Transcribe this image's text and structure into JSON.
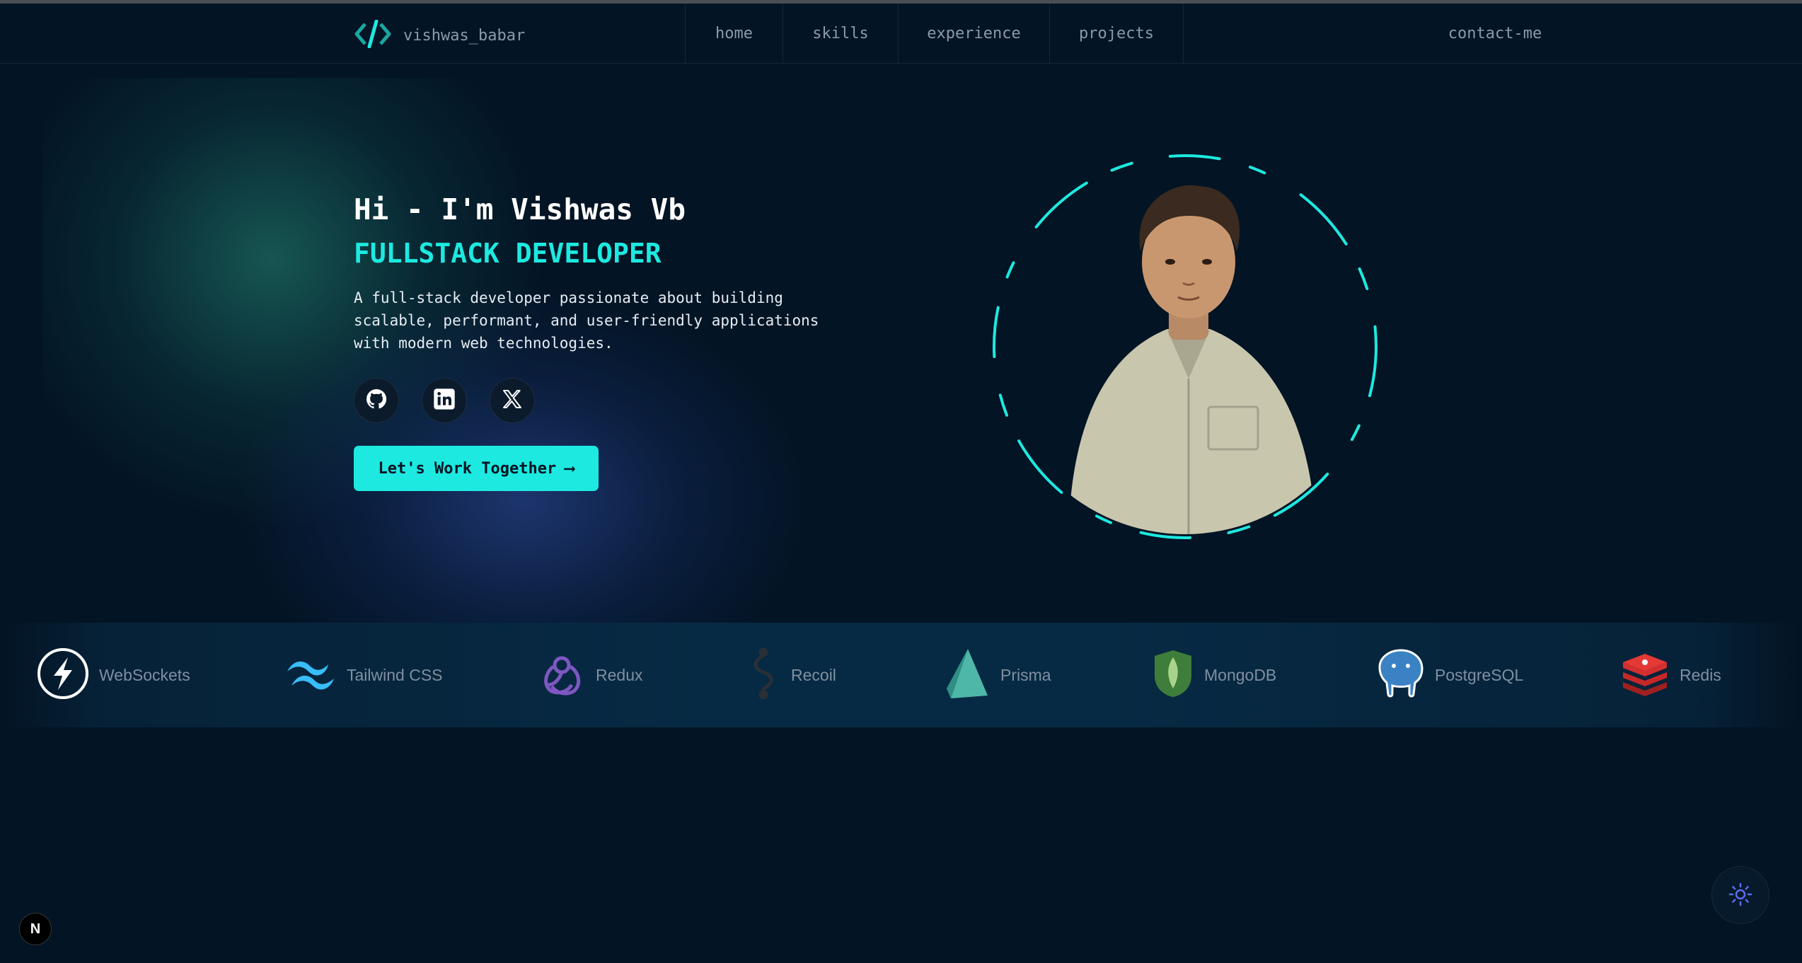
{
  "nav": {
    "brand_label": "vishwas_babar",
    "items": [
      {
        "label": "home"
      },
      {
        "label": "skills"
      },
      {
        "label": "experience"
      },
      {
        "label": "projects"
      },
      {
        "label": "contact-me"
      }
    ]
  },
  "hero": {
    "title": "Hi - I'm Vishwas Vb",
    "role": "FULLSTACK DEVELOPER",
    "description": "A full-stack developer passionate about building scalable, performant, and user-friendly applications with modern web technologies.",
    "socials": [
      {
        "icon": "github-icon"
      },
      {
        "icon": "linkedin-icon"
      },
      {
        "icon": "x-icon"
      }
    ],
    "cta_label": "Let's Work Together",
    "cta_arrow": "⟶"
  },
  "skills": [
    {
      "label": "WebSockets",
      "icon": "websockets-icon"
    },
    {
      "label": "Tailwind CSS",
      "icon": "tailwind-icon"
    },
    {
      "label": "Redux",
      "icon": "redux-icon"
    },
    {
      "label": "Recoil",
      "icon": "recoil-icon"
    },
    {
      "label": "Prisma",
      "icon": "prisma-icon"
    },
    {
      "label": "MongoDB",
      "icon": "mongodb-icon"
    },
    {
      "label": "PostgreSQL",
      "icon": "postgresql-icon"
    },
    {
      "label": "Redis",
      "icon": "redis-icon"
    }
  ],
  "corner": {
    "n_badge": "N",
    "theme_icon": "sun-icon"
  },
  "colors": {
    "background": "#031424",
    "accent": "#1de9e0",
    "muted_text": "#8b9aab"
  }
}
